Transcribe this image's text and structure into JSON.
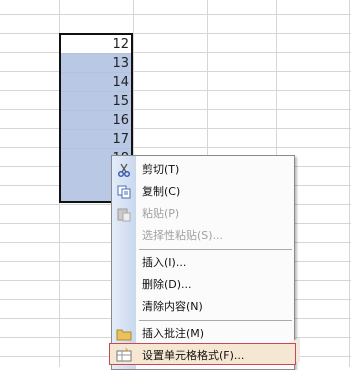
{
  "spreadsheet": {
    "cells": [
      "12",
      "13",
      "14",
      "15",
      "16",
      "17",
      "18"
    ]
  },
  "context_menu": {
    "cut": "剪切(T)",
    "copy": "复制(C)",
    "paste": "粘贴(P)",
    "paste_special": "选择性粘贴(S)...",
    "insert": "插入(I)...",
    "delete": "删除(D)...",
    "clear_contents": "清除内容(N)",
    "insert_comment": "插入批注(M)",
    "format_cells": "设置单元格格式(F)..."
  },
  "colors": {
    "selection": "#b9c9e5",
    "menu_side": "#c9d8ee",
    "highlight_border": "#c44a58"
  }
}
